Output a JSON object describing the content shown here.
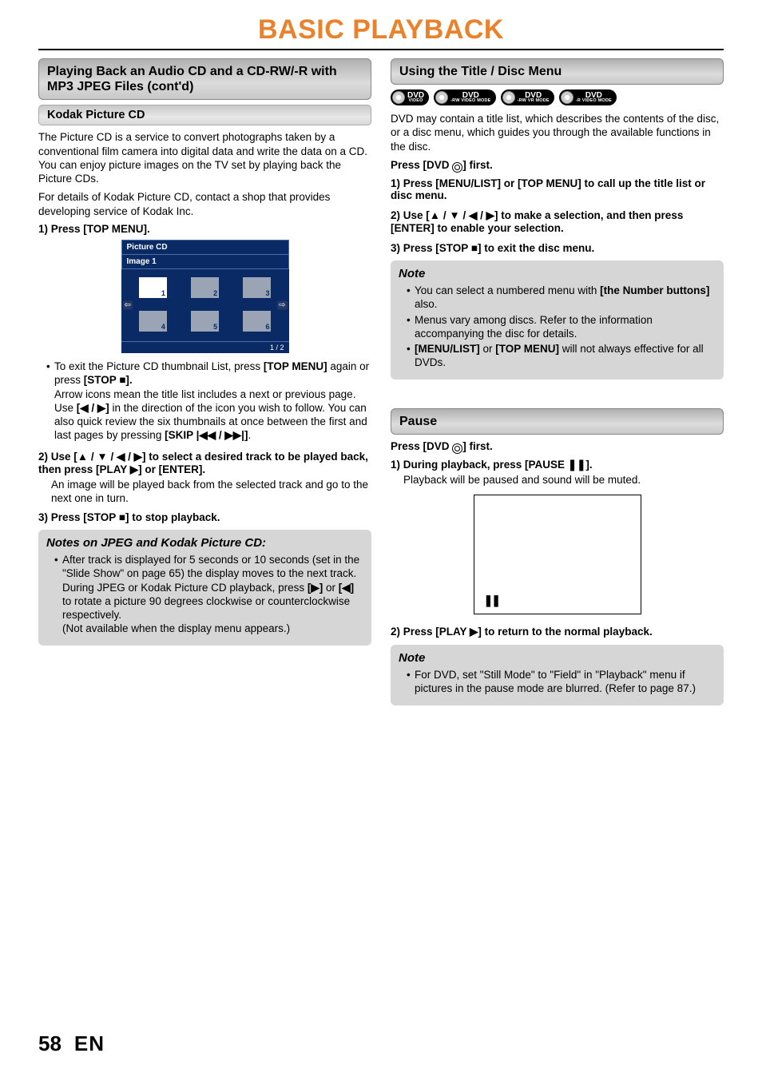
{
  "header": {
    "title": "BASIC PLAYBACK"
  },
  "footer": {
    "page": "58",
    "lang": "EN"
  },
  "left": {
    "section_title": "Playing Back an Audio CD and a CD-RW/-R with MP3 JPEG Files (cont'd)",
    "kodak_heading": "Kodak Picture CD",
    "kodak_para": "The Picture CD is a service to convert photographs taken by a conventional film camera into digital data and write the data on a CD. You can enjoy picture images on the TV set by playing back the Picture CDs.",
    "kodak_para2": "For details of Kodak Picture CD, contact a shop that provides developing service of Kodak Inc.",
    "step1": "1) Press [TOP MENU].",
    "pcd": {
      "title": "Picture CD",
      "subtitle": "Image 1",
      "thumbs": [
        "1",
        "2",
        "3",
        "4",
        "5",
        "6"
      ],
      "arrow_left": "⇦",
      "arrow_right": "⇨",
      "page_indicator": "1 / 2"
    },
    "bullet1_a": "To exit the Picture CD thumbnail List, press ",
    "bullet1_b": "[TOP MENU]",
    "bullet1_c": " again or press ",
    "bullet1_d": "[STOP ■].",
    "bullet1_body1": "Arrow icons mean the title list includes a next or previous page. Use ",
    "bullet1_body1b": "[◀ / ▶]",
    "bullet1_body1c": " in the direction of the icon you wish to follow. You can also quick review the six thumbnails at once between the first and last pages by pressing ",
    "bullet1_body1d": "[SKIP |◀◀ / ▶▶|]",
    "bullet1_body1e": ".",
    "step2a": "2) Use [▲ / ▼ / ◀ / ▶] to select a desired track to be played back, then press [PLAY ▶] or [ENTER].",
    "step2_body": "An image will be played back from the selected track and go to the next one in turn.",
    "step3": "3) Press [STOP ■] to stop playback.",
    "notes_title": "Notes on JPEG and Kodak Picture CD:",
    "notes_bullet_a": "After track is displayed for 5 seconds or 10 seconds (set in the \"Slide Show\" on page 65) the display moves to the next track.",
    "notes_bullet_b1": "During JPEG or Kodak Picture CD playback, press ",
    "notes_bullet_b2": "[▶]",
    "notes_bullet_b3": " or ",
    "notes_bullet_b4": "[◀]",
    "notes_bullet_b5": " to rotate a picture 90 degrees clockwise or counterclockwise respectively.",
    "notes_bullet_c": "(Not available when the display menu appears.)"
  },
  "right": {
    "title_menu_heading": "Using the Title / Disc Menu",
    "badges": [
      {
        "main": "DVD",
        "sub": "VIDEO"
      },
      {
        "main": "DVD",
        "sub": "-RW VIDEO MODE"
      },
      {
        "main": "DVD",
        "sub": "-RW VR MODE"
      },
      {
        "main": "DVD",
        "sub": "-R VIDEO MODE"
      }
    ],
    "title_menu_para": "DVD may contain a title list, which describes the contents of the disc, or a disc menu, which guides you through the available functions in the disc.",
    "press_dvd_first": "Press [DVD ⊚] first.",
    "tm_step1": "1) Press [MENU/LIST] or [TOP MENU] to call up the title list or disc menu.",
    "tm_step2": "2) Use [▲ / ▼ / ◀ / ▶] to make a selection, and then press [ENTER] to enable your selection.",
    "tm_step3": "3) Press [STOP ■] to exit the disc menu.",
    "tm_note_title": "Note",
    "tm_note1a": "You can select a numbered menu with ",
    "tm_note1b": "[the Number buttons]",
    "tm_note1c": " also.",
    "tm_note2": "Menus vary among discs. Refer to the information accompanying the disc for details.",
    "tm_note3a": "[MENU/LIST]",
    "tm_note3b": " or ",
    "tm_note3c": "[TOP MENU]",
    "tm_note3d": " will not always effective for all DVDs.",
    "pause_heading": "Pause",
    "pause_press_first": "Press [DVD ⊚] first.",
    "pause_step1": "1) During playback, press [PAUSE ❚❚].",
    "pause_step1_body": "Playback will be paused and sound will be muted.",
    "pause_glyph": "❚❚",
    "pause_step2": "2) Press [PLAY ▶] to return to the normal playback.",
    "pause_note_title": "Note",
    "pause_note_body": "For DVD, set \"Still Mode\" to \"Field\" in \"Playback\" menu if pictures in the pause mode are blurred. (Refer to page 87.)"
  }
}
